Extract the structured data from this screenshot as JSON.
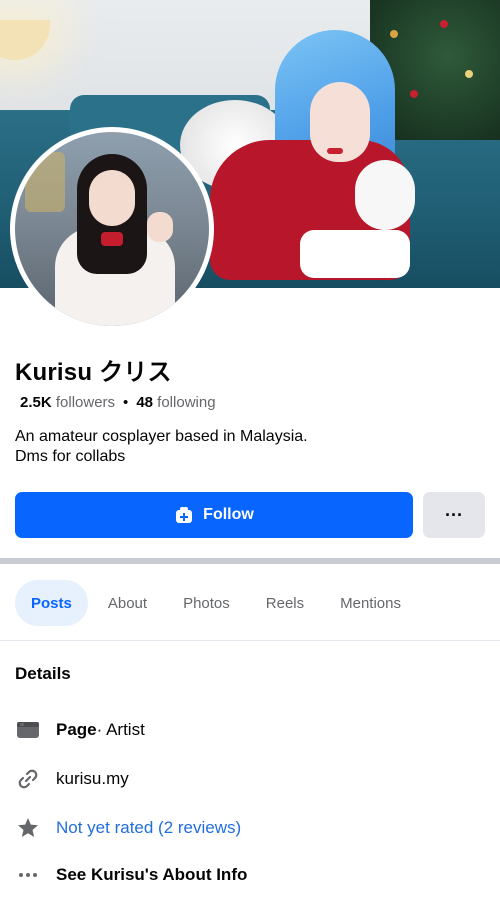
{
  "profile": {
    "name": "Kurisu クリス",
    "followers_count": "2.5K",
    "followers_label": "followers",
    "following_count": "48",
    "following_label": "following",
    "bio_line1": "An amateur cosplayer based in Malaysia.",
    "bio_line2": "Dms for collabs"
  },
  "actions": {
    "follow_label": "Follow",
    "more_label": "···"
  },
  "tabs": [
    {
      "label": "Posts",
      "active": true
    },
    {
      "label": "About",
      "active": false
    },
    {
      "label": "Photos",
      "active": false
    },
    {
      "label": "Reels",
      "active": false
    },
    {
      "label": "Mentions",
      "active": false
    }
  ],
  "details": {
    "title": "Details",
    "page_type_bold": "Page",
    "page_type_rest": " · Artist",
    "website": "kurisu.my",
    "rating": "Not yet rated (2 reviews)",
    "about_info": "See Kurisu's About Info"
  },
  "icons": {
    "follow": "add-person-icon",
    "page": "page-flag-icon",
    "link": "link-icon",
    "star": "star-icon",
    "more": "more-dots-icon"
  },
  "colors": {
    "accent": "#0866ff",
    "link": "#216fdb",
    "tab_active_bg": "#e7f0fd"
  }
}
